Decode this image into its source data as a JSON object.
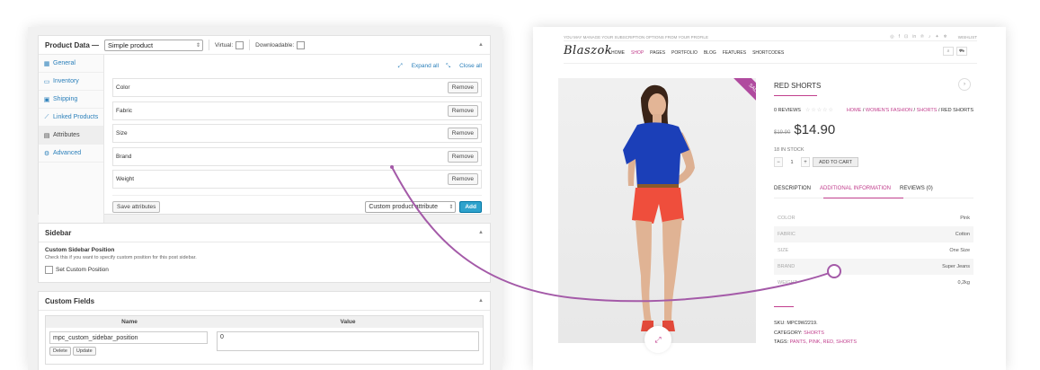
{
  "admin": {
    "product_data": {
      "title": "Product Data —",
      "type_select": "Simple product",
      "virtual_label": "Virtual:",
      "downloadable_label": "Downloadable:",
      "tabs": [
        {
          "icon": "▦",
          "label": "General"
        },
        {
          "icon": "▭",
          "label": "Inventory"
        },
        {
          "icon": "▣",
          "label": "Shipping"
        },
        {
          "icon": "⟋",
          "label": "Linked Products"
        },
        {
          "icon": "▤",
          "label": "Attributes"
        },
        {
          "icon": "⚙",
          "label": "Advanced"
        }
      ],
      "expand_all": "Expand all",
      "close_all": "Close all",
      "attributes": [
        "Color",
        "Fabric",
        "Size",
        "Brand",
        "Weight"
      ],
      "remove_label": "Remove",
      "save_attributes": "Save attributes",
      "custom_attr_select": "Custom product attribute",
      "add_label": "Add"
    },
    "sidebar": {
      "title": "Sidebar",
      "field_title": "Custom Sidebar Position",
      "field_desc": "Check this if you want to specify custom position for this post sidebar.",
      "checkbox_label": "Set Custom Position"
    },
    "custom_fields": {
      "title": "Custom Fields",
      "col_name": "Name",
      "col_value": "Value",
      "row_name": "mpc_custom_sidebar_position",
      "row_value": "0",
      "delete_label": "Delete",
      "update_label": "Update"
    }
  },
  "store": {
    "topbar_text": "YOU MAY MANAGE YOUR SUBSCRIPTION OPTIONS FROM YOUR PROFILE",
    "socials": [
      "◎",
      "f",
      "⊡",
      "in",
      "℗",
      "♪",
      "✦",
      "❄"
    ],
    "wishlist": "WISHLIST",
    "logo": "Blaszok",
    "nav": [
      "HOME",
      "SHOP",
      "PAGES",
      "PORTFOLIO",
      "BLOG",
      "FEATURES",
      "SHORTCODES"
    ],
    "sale_badge": "SALE!",
    "product_title": "RED SHORTS",
    "reviews_count": "0 REVIEWS",
    "breadcrumb": {
      "home": "HOME",
      "cat1": "WOMEN'S FASHION",
      "cat2": "SHORTS",
      "current": "RED SHORTS"
    },
    "old_price": "$19.90",
    "new_price": "$14.90",
    "stock": "18 IN STOCK",
    "qty": "1",
    "add_to_cart": "ADD TO CART",
    "tabs": [
      "DESCRIPTION",
      "ADDITIONAL INFORMATION",
      "REVIEWS (0)"
    ],
    "attributes": [
      {
        "key": "COLOR",
        "value": "Pink"
      },
      {
        "key": "FABRIC",
        "value": "Cotton"
      },
      {
        "key": "SIZE",
        "value": "One Size"
      },
      {
        "key": "BRAND",
        "value": "Super Jeans"
      },
      {
        "key": "WEIGHT",
        "value": "0,2kg"
      }
    ],
    "sku_label": "SKU:",
    "sku_value": "MPC9W2219.",
    "category_label": "CATEGORY:",
    "category_value": "SHORTS",
    "tags_label": "TAGS:",
    "tags_value": "PANTS, PINK, RED, SHORTS"
  },
  "colors": {
    "accent": "#c13e8d",
    "admin_link": "#2a7fba",
    "add_button": "#2ea2cc"
  }
}
